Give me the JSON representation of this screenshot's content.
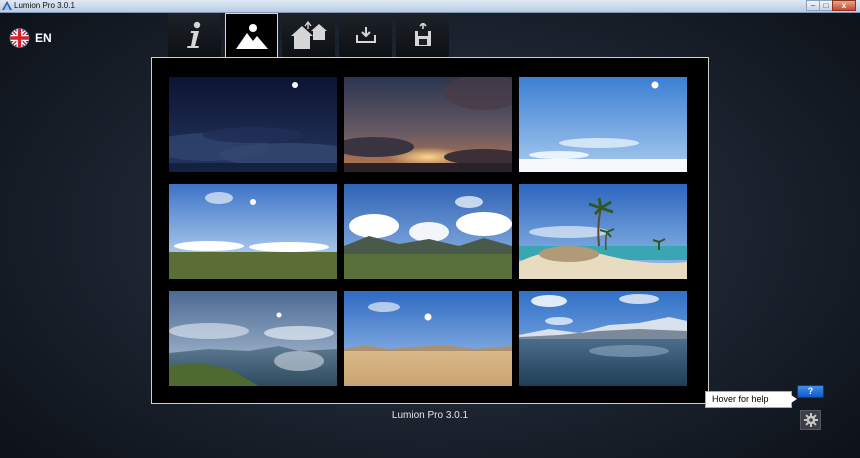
{
  "window": {
    "title": "Lumion Pro  3.0.1",
    "minimize_glyph": "–",
    "maximize_glyph": "□",
    "close_glyph": "x"
  },
  "language": {
    "code": "EN",
    "flag_icon": "uk-flag-icon"
  },
  "tabs": [
    {
      "id": "info",
      "icon": "info-icon",
      "active": false
    },
    {
      "id": "new-scene",
      "icon": "landscape-icon",
      "active": true
    },
    {
      "id": "example-scenes",
      "icon": "houses-icon",
      "active": false
    },
    {
      "id": "load-scene",
      "icon": "load-tray-icon",
      "active": false
    },
    {
      "id": "save-scene",
      "icon": "save-disk-icon",
      "active": false
    }
  ],
  "scenes": [
    {
      "id": "night",
      "theme": "night-sky"
    },
    {
      "id": "sunset",
      "theme": "sunset"
    },
    {
      "id": "sky",
      "theme": "blue-sky"
    },
    {
      "id": "grassland",
      "theme": "grass-plain"
    },
    {
      "id": "mountains",
      "theme": "mountain-grass"
    },
    {
      "id": "tropical",
      "theme": "tropical-island"
    },
    {
      "id": "lake",
      "theme": "water-coast"
    },
    {
      "id": "desert",
      "theme": "desert"
    },
    {
      "id": "snow",
      "theme": "snow-ocean"
    }
  ],
  "footer": {
    "version_label": "Lumion Pro  3.0.1"
  },
  "help": {
    "button_label": "?",
    "tooltip": "Hover for help"
  },
  "colors": {
    "accent_blue": "#1f6fdc",
    "panel_border": "#d0d0d0",
    "panel_bg": "#000000"
  }
}
